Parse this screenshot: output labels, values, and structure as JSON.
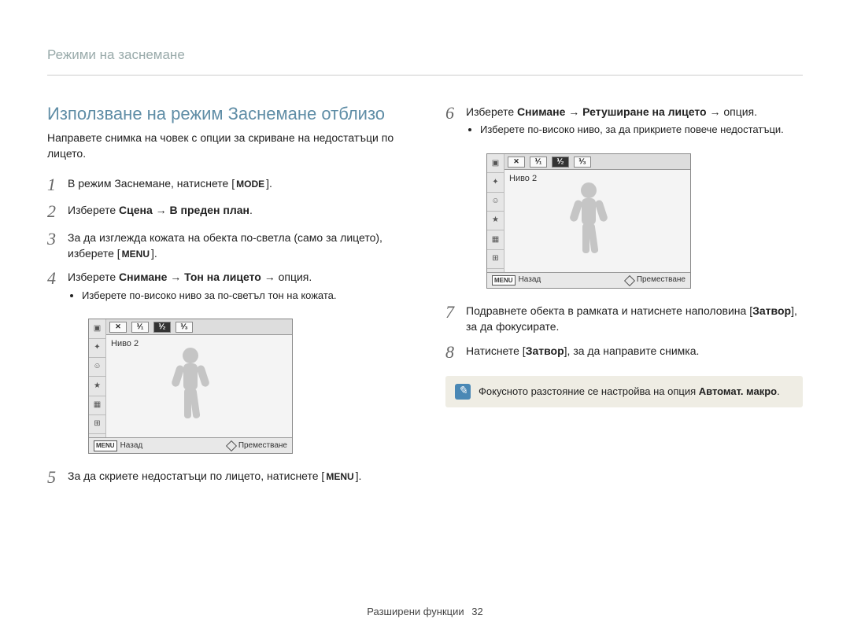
{
  "breadcrumb": "Режими на заснемане",
  "section_title": "Използване на режим Заснемане отблизо",
  "intro": "Направете снимка на човек с опции за скриване на недостатъци по лицето.",
  "keys": {
    "mode": "MODE",
    "menu": "MENU"
  },
  "left_steps": [
    {
      "n": "1",
      "pre": "В режим Заснемане, натиснете [",
      "key": "mode",
      "post": "]."
    },
    {
      "n": "2",
      "html": "Изберете <b>Сцена</b> → <b>В преден план</b>."
    },
    {
      "n": "3",
      "pre": "За да изглежда кожата на обекта по-светла (само за лицето), изберете [",
      "key": "menu",
      "post": "]."
    },
    {
      "n": "4",
      "html": "Изберете <b>Снимане</b> → <b>Тон на лицето</b> → опция.",
      "sub": [
        "Изберете по-високо ниво за по-светъл тон на кожата."
      ]
    },
    {
      "n": "5",
      "pre": "За да скриете недостатъци по лицето, натиснете [",
      "key": "menu",
      "post": "]."
    }
  ],
  "right_steps": [
    {
      "n": "6",
      "html": "Изберете <b>Снимане</b> → <b>Ретуширане на лицето</b> → опция.",
      "sub": [
        "Изберете по-високо ниво, за да прикриете повече недостатъци."
      ]
    },
    {
      "n": "7",
      "html": "Подравнете обекта в рамката и натиснете наполовина [<b>Затвор</b>], за да фокусирате."
    },
    {
      "n": "8",
      "html": "Натиснете [<b>Затвор</b>], за да направите снимка."
    }
  ],
  "camera": {
    "segments": [
      "✕",
      "⅟₁",
      "⅟₂",
      "⅟₃"
    ],
    "selected_index": 2,
    "level_label": "Ниво 2",
    "back_label": "Назад",
    "move_label": "Преместване",
    "menu_tag": "MENU",
    "side_glyphs": [
      "▣",
      "✦",
      "☺",
      "★",
      "▦",
      "⊞",
      "✋"
    ]
  },
  "note": {
    "text_pre": "Фокусното разстояние се настройва на опция ",
    "bold": "Автомат. макро",
    "text_post": "."
  },
  "footer": {
    "label": "Разширени функции",
    "page": "32"
  }
}
